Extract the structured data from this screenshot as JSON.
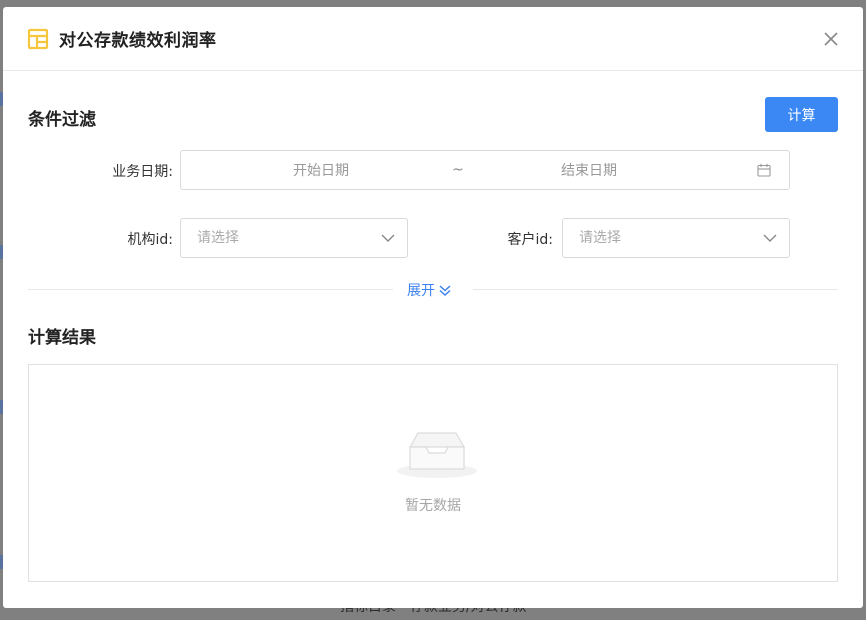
{
  "dialog": {
    "title": "对公存款绩效利润率",
    "colors": {
      "primary": "#3b88f5",
      "link": "#3b82f0",
      "title_icon": "#f7c63f"
    }
  },
  "filter": {
    "section_title": "条件过滤",
    "calc_button": "计算",
    "business_date": {
      "label": "业务日期:",
      "start_placeholder": "开始日期",
      "separator": "~",
      "end_placeholder": "结束日期",
      "icon": "calendar-icon"
    },
    "org_id": {
      "label": "机构id:",
      "placeholder": "请选择",
      "icon": "chevron-down-icon"
    },
    "customer_id": {
      "label": "客户id:",
      "placeholder": "请选择",
      "icon": "chevron-down-icon"
    },
    "expand_label": "展开",
    "expand_icon": "double-chevron-down-icon"
  },
  "result": {
    "section_title": "计算结果",
    "empty_text": "暂无数据",
    "empty_icon": "empty-inbox-icon"
  },
  "background": {
    "partial_text": "指标目录 - 存款业务/对公存款"
  }
}
